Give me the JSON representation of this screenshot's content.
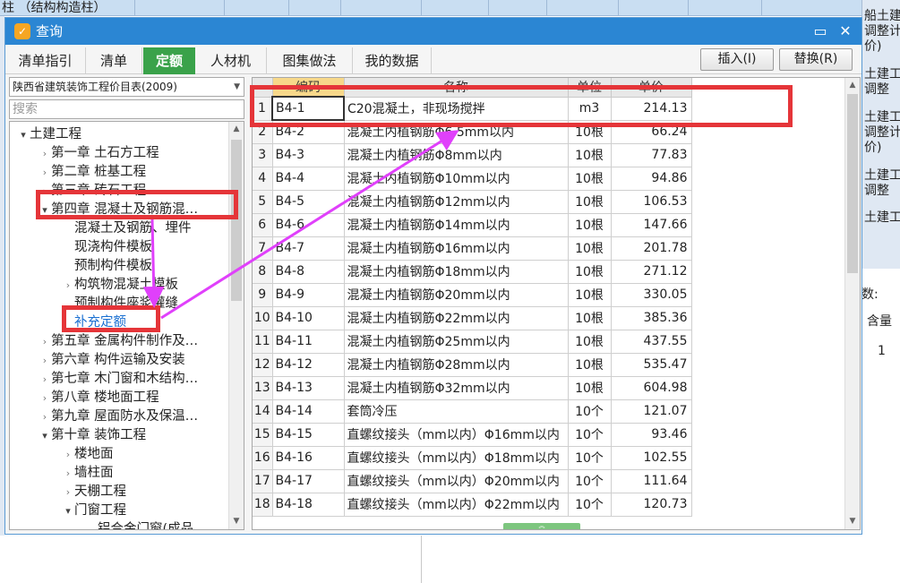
{
  "background": {
    "top_text": "柱 （结构构造柱）",
    "right_top_fragments": [
      "船土建工程",
      "调整计",
      "价)",
      "土建工程",
      "调整",
      "土建工程",
      "调整计",
      "价)",
      "土建工程",
      "调整",
      "土建工程"
    ],
    "right_bottom": {
      "count_label": "数:",
      "col_header": "含量",
      "value": "1"
    }
  },
  "dialog": {
    "title": "查询",
    "minimize_label": "▭",
    "close_label": "✕",
    "tabs": [
      {
        "label": "清单指引"
      },
      {
        "label": "清单"
      },
      {
        "label": "定额"
      },
      {
        "label": "人材机"
      },
      {
        "label": "图集做法"
      },
      {
        "label": "我的数据"
      }
    ],
    "insert_label": "插入(I)",
    "replace_label": "替换(R)"
  },
  "library": {
    "selected": "陕西省建筑装饰工程价目表(2009)",
    "search_placeholder": "搜索"
  },
  "tree": [
    {
      "label": "土建工程",
      "level": 0,
      "toggle": "open"
    },
    {
      "label": "第一章  土石方工程",
      "level": 1,
      "toggle": "closed"
    },
    {
      "label": "第二章  桩基工程",
      "level": 1,
      "toggle": "closed"
    },
    {
      "label": "第三章  砖石工程",
      "level": 1,
      "toggle": "closed"
    },
    {
      "label": "第四章  混凝土及钢筋混…",
      "level": 1,
      "toggle": "open"
    },
    {
      "label": "混凝土及钢筋、埋件",
      "level": 2,
      "toggle": "none"
    },
    {
      "label": "现浇构件模板",
      "level": 2,
      "toggle": "none"
    },
    {
      "label": "预制构件模板",
      "level": 2,
      "toggle": "none"
    },
    {
      "label": "构筑物混凝土模板",
      "level": 2,
      "toggle": "closed"
    },
    {
      "label": "预制构件座浆灌缝",
      "level": 2,
      "toggle": "none"
    },
    {
      "label": "补充定额",
      "level": 2,
      "toggle": "none",
      "link": true
    },
    {
      "label": "第五章  金属构件制作及…",
      "level": 1,
      "toggle": "closed"
    },
    {
      "label": "第六章  构件运输及安装",
      "level": 1,
      "toggle": "closed"
    },
    {
      "label": "第七章  木门窗和木结构…",
      "level": 1,
      "toggle": "closed"
    },
    {
      "label": "第八章  楼地面工程",
      "level": 1,
      "toggle": "closed"
    },
    {
      "label": "第九章  屋面防水及保温…",
      "level": 1,
      "toggle": "closed"
    },
    {
      "label": "第十章  装饰工程",
      "level": 1,
      "toggle": "open"
    },
    {
      "label": "楼地面",
      "level": 2,
      "toggle": "closed"
    },
    {
      "label": "墙柱面",
      "level": 2,
      "toggle": "closed"
    },
    {
      "label": "天棚工程",
      "level": 2,
      "toggle": "closed"
    },
    {
      "label": "门窗工程",
      "level": 2,
      "toggle": "open"
    },
    {
      "label": "铝合金门窗(成品…",
      "level": 3,
      "toggle": "none"
    }
  ],
  "grid": {
    "headers": [
      "",
      "编码",
      "名称",
      "单位",
      "单价"
    ],
    "rows": [
      {
        "idx": "1",
        "code": "B4-1",
        "name": "C20混凝土，非现场搅拌",
        "unit": "m3",
        "price": "214.13"
      },
      {
        "idx": "2",
        "code": "B4-2",
        "name": "混凝土内植钢筋Φ6.5mm以内",
        "unit": "10根",
        "price": "66.24"
      },
      {
        "idx": "3",
        "code": "B4-3",
        "name": "混凝土内植钢筋Φ8mm以内",
        "unit": "10根",
        "price": "77.83"
      },
      {
        "idx": "4",
        "code": "B4-4",
        "name": "混凝土内植钢筋Φ10mm以内",
        "unit": "10根",
        "price": "94.86"
      },
      {
        "idx": "5",
        "code": "B4-5",
        "name": "混凝土内植钢筋Φ12mm以内",
        "unit": "10根",
        "price": "106.53"
      },
      {
        "idx": "6",
        "code": "B4-6",
        "name": "混凝土内植钢筋Φ14mm以内",
        "unit": "10根",
        "price": "147.66"
      },
      {
        "idx": "7",
        "code": "B4-7",
        "name": "混凝土内植钢筋Φ16mm以内",
        "unit": "10根",
        "price": "201.78"
      },
      {
        "idx": "8",
        "code": "B4-8",
        "name": "混凝土内植钢筋Φ18mm以内",
        "unit": "10根",
        "price": "271.12"
      },
      {
        "idx": "9",
        "code": "B4-9",
        "name": "混凝土内植钢筋Φ20mm以内",
        "unit": "10根",
        "price": "330.05"
      },
      {
        "idx": "10",
        "code": "B4-10",
        "name": "混凝土内植钢筋Φ22mm以内",
        "unit": "10根",
        "price": "385.36"
      },
      {
        "idx": "11",
        "code": "B4-11",
        "name": "混凝土内植钢筋Φ25mm以内",
        "unit": "10根",
        "price": "437.55"
      },
      {
        "idx": "12",
        "code": "B4-12",
        "name": "混凝土内植钢筋Φ28mm以内",
        "unit": "10根",
        "price": "535.47"
      },
      {
        "idx": "13",
        "code": "B4-13",
        "name": "混凝土内植钢筋Φ32mm以内",
        "unit": "10根",
        "price": "604.98"
      },
      {
        "idx": "14",
        "code": "B4-14",
        "name": "套筒冷压",
        "unit": "10个",
        "price": "121.07"
      },
      {
        "idx": "15",
        "code": "B4-15",
        "name": "直螺纹接头（mm以内）Φ16mm以内",
        "unit": "10个",
        "price": "93.46"
      },
      {
        "idx": "16",
        "code": "B4-16",
        "name": "直螺纹接头（mm以内）Φ18mm以内",
        "unit": "10个",
        "price": "102.55"
      },
      {
        "idx": "17",
        "code": "B4-17",
        "name": "直螺纹接头（mm以内）Φ20mm以内",
        "unit": "10个",
        "price": "111.64"
      },
      {
        "idx": "18",
        "code": "B4-18",
        "name": "直螺纹接头（mm以内）Φ22mm以内",
        "unit": "10个",
        "price": "120.73"
      }
    ]
  },
  "colors": {
    "title_bar": "#2b86d3",
    "active_tab": "#3aa24a",
    "annotation_box": "#e53539",
    "annotation_arrow": "#e040fb"
  }
}
